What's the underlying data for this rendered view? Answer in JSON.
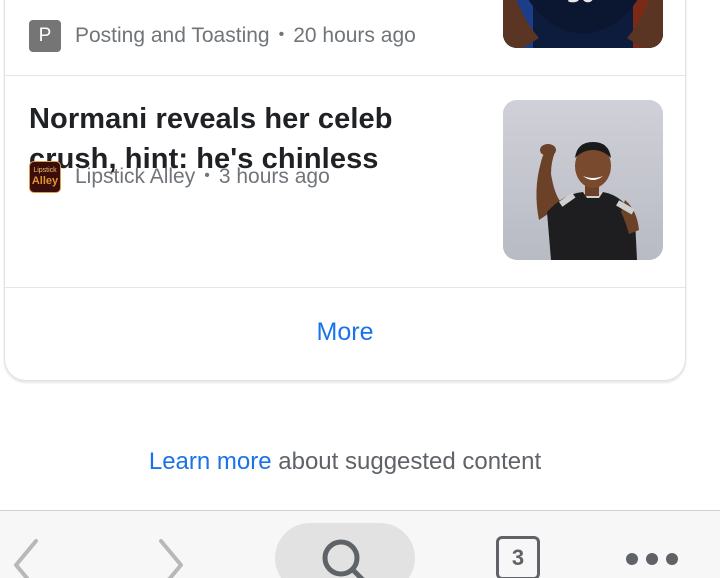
{
  "feed": {
    "stories": [
      {
        "source": "Posting and Toasting",
        "source_icon_letter": "P",
        "time": "20 hours ago"
      },
      {
        "headline": "Normani reveals her celeb crush, hint: he's chinless",
        "source": "Lipstick Alley",
        "source_icon_text_top": "Lipstick",
        "source_icon_text_bottom": "Alley",
        "time": "3 hours ago"
      }
    ],
    "more_label": "More"
  },
  "footer": {
    "learn_more_link": "Learn more",
    "learn_more_rest": "about suggested content"
  },
  "toolbar": {
    "tab_count": "3"
  },
  "colors": {
    "link": "#1a73e8",
    "secondary_text": "#70757a",
    "headline_text": "#202124",
    "toolbar_icon": "#5f6368"
  }
}
